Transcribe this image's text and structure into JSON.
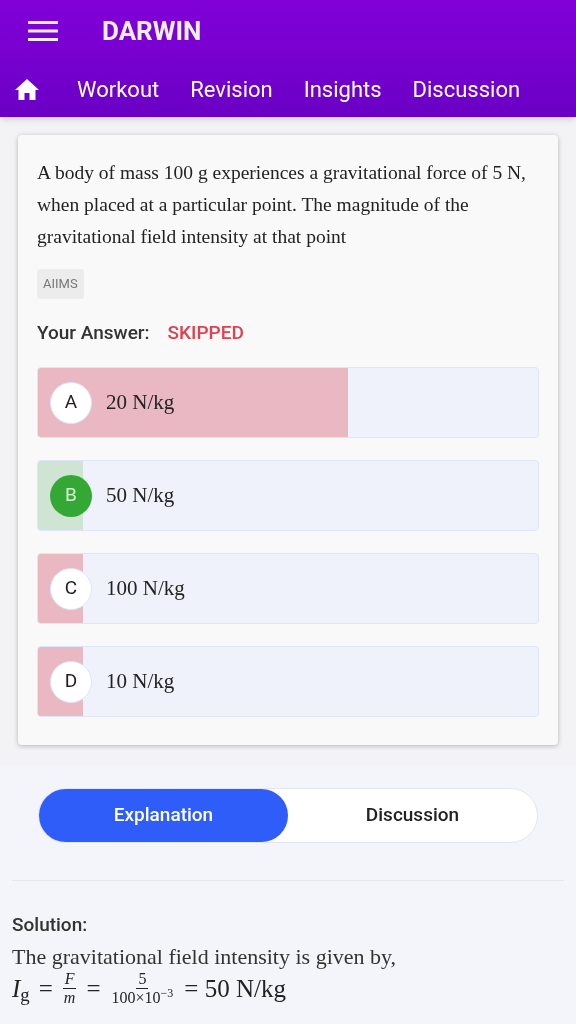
{
  "app_bar": {
    "title": "DARWIN"
  },
  "nav_tabs": [
    {
      "label": "Workout"
    },
    {
      "label": "Revision"
    },
    {
      "label": "Insights"
    },
    {
      "label": "Discussion"
    }
  ],
  "question": {
    "text": "A body of mass 100 g experiences a gravitational force of 5 N, when placed at a particular point. The magnitude of the gravitational field intensity at that point",
    "tag": "AIIMS",
    "answer_label": "Your Answer:",
    "answer_value": "SKIPPED"
  },
  "options": [
    {
      "letter": "A",
      "text": "20 N/kg",
      "correct": false,
      "level": 0.62
    },
    {
      "letter": "B",
      "text": "50 N/kg",
      "correct": true,
      "level": 0.09
    },
    {
      "letter": "C",
      "text": "100 N/kg",
      "correct": false,
      "level": 0.09
    },
    {
      "letter": "D",
      "text": "10 N/kg",
      "correct": false,
      "level": 0.09
    }
  ],
  "toggle": [
    {
      "label": "Explanation",
      "selected": true
    },
    {
      "label": "Discussion",
      "selected": false
    }
  ],
  "solution": {
    "heading": "Solution:",
    "text": "The gravitational field intensity is given by,",
    "equation": [
      {
        "kind": "text",
        "text": "*I*$_{g}$"
      },
      {
        "kind": "text",
        "text": "="
      },
      {
        "kind": "fraction",
        "numerator": "*F*",
        "denominator": "*m*"
      },
      {
        "kind": "text",
        "text": "="
      },
      {
        "kind": "fraction",
        "numerator": "5",
        "denominator": "100×10$^{−3}$"
      },
      {
        "kind": "text",
        "text": "= 50 N/kg"
      }
    ]
  }
}
